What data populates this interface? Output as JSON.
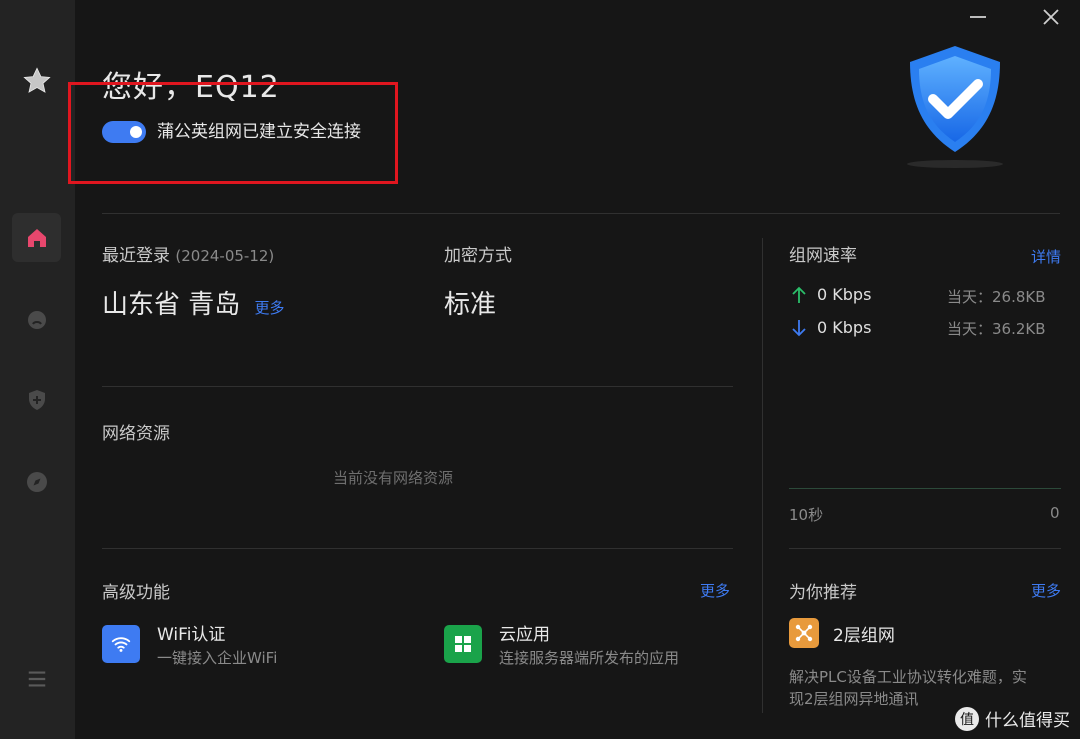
{
  "sidebar": {
    "items": [
      {
        "icon": "star-icon",
        "name": "nav-favorites"
      },
      {
        "icon": "home-icon",
        "name": "nav-home"
      },
      {
        "icon": "chat-icon",
        "name": "nav-messages"
      },
      {
        "icon": "shield-plus-icon",
        "name": "nav-security"
      },
      {
        "icon": "compass-icon",
        "name": "nav-discover"
      },
      {
        "icon": "menu-icon",
        "name": "nav-menu"
      }
    ],
    "active_color": "#e8476d"
  },
  "window": {
    "minimize": "—",
    "close": "✕"
  },
  "header": {
    "greeting": "您好，EQ12",
    "connection_status": "蒲公英组网已建立安全连接",
    "toggle_on": true
  },
  "login": {
    "label": "最近登录",
    "date": "(2024-05-12)",
    "location": "山东省 青岛",
    "more": "更多"
  },
  "encryption": {
    "label": "加密方式",
    "value": "标准"
  },
  "network_resources": {
    "label": "网络资源",
    "empty_text": "当前没有网络资源"
  },
  "speed": {
    "label": "组网速率",
    "detail_link": "详情",
    "upload": {
      "rate": "0 Kbps",
      "today": "当天：26.8KB"
    },
    "download": {
      "rate": "0 Kbps",
      "today": "当天：36.2KB"
    },
    "axis_left": "10秒",
    "axis_right": "0"
  },
  "advanced": {
    "label": "高级功能",
    "more": "更多",
    "items": [
      {
        "title": "WiFi认证",
        "desc": "一键接入企业WiFi",
        "color": "#3e7bf2"
      },
      {
        "title": "云应用",
        "desc": "连接服务器端所发布的应用",
        "color": "#1aa34a"
      }
    ]
  },
  "recommend": {
    "label": "为你推荐",
    "more": "更多",
    "item_title": "2层组网",
    "item_desc_line1": "解决PLC设备工业协议转化难题，实",
    "item_desc_line2": "现2层组网异地通讯",
    "icon_color": "#e89a3c"
  },
  "watermark": {
    "glyph": "值",
    "text": "什么值得买"
  },
  "colors": {
    "accent": "#3e7bf2",
    "highlight_box": "#e0161f",
    "up_arrow": "#2bbf6a",
    "down_arrow": "#3e7bf2"
  }
}
